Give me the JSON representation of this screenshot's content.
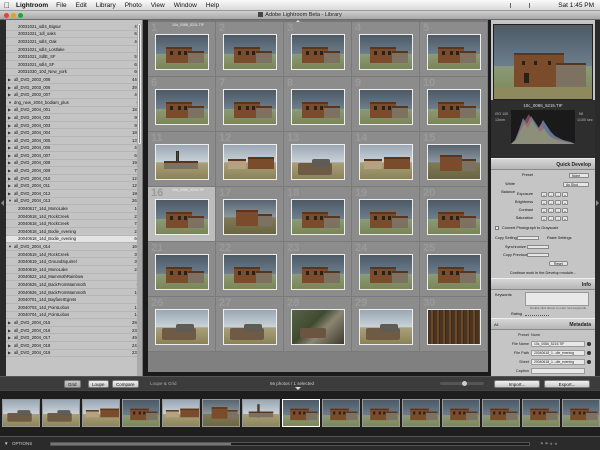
{
  "menubar": {
    "app": "Lightroom",
    "items": [
      "File",
      "Edit",
      "Library",
      "Photo",
      "View",
      "Window",
      "Help"
    ],
    "clock": "Sat 1:45 PM"
  },
  "window": {
    "title": "Adobe Lightroom Beta - Library"
  },
  "folders": [
    {
      "label": "20031021_sdl4_Bigsur",
      "count": "47"
    },
    {
      "label": "20031021_1dl_oaks",
      "count": "63"
    },
    {
      "label": "20031021_sdl4_Oak",
      "count": "46"
    },
    {
      "label": "20031021_sdl4_Lostlake",
      "count": "4"
    },
    {
      "label": "20031021_SdlE_SF",
      "count": "57"
    },
    {
      "label": "20031021_sdl4_SF",
      "count": "68"
    },
    {
      "label": "20031030_10d_New_york",
      "count": "60"
    },
    {
      "label": "all_DVD_2003_008",
      "count": "446",
      "toggle": "▶"
    },
    {
      "label": "all_DVD_2003_006",
      "count": "397",
      "toggle": "▶"
    },
    {
      "label": "all_DVD_2003_007",
      "count": "46",
      "toggle": "▶"
    },
    {
      "label": "dng_new_2004_bodiam_plus",
      "count": "0",
      "toggle": "▼"
    },
    {
      "label": "all_DVD_2004_001",
      "count": "182",
      "toggle": "▶"
    },
    {
      "label": "all_DVD_2004_002",
      "count": "90",
      "toggle": "▶"
    },
    {
      "label": "all_DVD_2004_003",
      "count": "95",
      "toggle": "▶"
    },
    {
      "label": "all_DVD_2004_004",
      "count": "188",
      "toggle": "▶"
    },
    {
      "label": "all_DVD_2004_005",
      "count": "137",
      "toggle": "▶"
    },
    {
      "label": "all_DVD_2004_006",
      "count": "43",
      "toggle": "▶"
    },
    {
      "label": "all_DVD_2004_007",
      "count": "63",
      "toggle": "▶"
    },
    {
      "label": "all_DVD_2004_008",
      "count": "194",
      "toggle": "▶"
    },
    {
      "label": "all_DVD_2004_009",
      "count": "73",
      "toggle": "▶"
    },
    {
      "label": "all_DVD_2004_010",
      "count": "122",
      "toggle": "▶"
    },
    {
      "label": "all_DVD_2004_011",
      "count": "129",
      "toggle": "▶"
    },
    {
      "label": "all_DVD_2004_012",
      "count": "180",
      "toggle": "▶"
    },
    {
      "label": "all_DVD_2004_013",
      "count": "263",
      "toggle": "▼"
    },
    {
      "label": "20040617_14d_MonoLake",
      "count": "16"
    },
    {
      "label": "20040618_14d_RockCreek",
      "count": "23"
    },
    {
      "label": "20040618_14d_RockCreek",
      "count": "74"
    },
    {
      "label": "20040618_14d_Bodie_evening",
      "count": "24"
    },
    {
      "label": "20040618_14d_Bodie_evening",
      "count": "66",
      "selected": true
    },
    {
      "label": "all_DVD_2004_014",
      "count": "169",
      "toggle": "▼"
    },
    {
      "label": "20040619_14d_RockCreek",
      "count": "35"
    },
    {
      "label": "20040619_14d_GroundSquirrel",
      "count": "39"
    },
    {
      "label": "20040619_14d_MonoLake",
      "count": "24"
    },
    {
      "label": "20040622_14d_MammothRainbow",
      "count": "2"
    },
    {
      "label": "20040625_14d_BackFromMammoth",
      "count": "5"
    },
    {
      "label": "20040626_14d_BackFromMammoth",
      "count": "15"
    },
    {
      "label": "20040701_14d_BayfarerEgrets",
      "count": "3"
    },
    {
      "label": "20040703_14d_PointLobos",
      "count": "17"
    },
    {
      "label": "20040704_14d_PointLobos",
      "count": "13"
    },
    {
      "label": "all_DVD_2004_015",
      "count": "284",
      "toggle": "▶"
    },
    {
      "label": "all_DVD_2004_016",
      "count": "233",
      "toggle": "▶"
    },
    {
      "label": "all_DVD_2004_017",
      "count": "494",
      "toggle": "▶"
    },
    {
      "label": "all_DVD_2004_018",
      "count": "243",
      "toggle": "▶"
    },
    {
      "label": "all_DVD_2004_019",
      "count": "233",
      "toggle": "▶"
    }
  ],
  "grid": {
    "cells": [
      {
        "num": "1",
        "fname": "10d_0086_5211.TIF"
      },
      {
        "num": "2",
        "fname": ""
      },
      {
        "num": "3",
        "fname": ""
      },
      {
        "num": "4",
        "fname": ""
      },
      {
        "num": "5",
        "fname": ""
      },
      {
        "num": "6",
        "fname": ""
      },
      {
        "num": "7",
        "fname": ""
      },
      {
        "num": "8",
        "fname": ""
      },
      {
        "num": "9",
        "fname": ""
      },
      {
        "num": "10",
        "fname": ""
      },
      {
        "num": "11",
        "fname": ""
      },
      {
        "num": "12",
        "fname": ""
      },
      {
        "num": "13",
        "fname": ""
      },
      {
        "num": "14",
        "fname": ""
      },
      {
        "num": "15",
        "fname": ""
      },
      {
        "num": "16",
        "fname": "10d_0086_5215.TIF",
        "selected": true
      },
      {
        "num": "17",
        "fname": ""
      },
      {
        "num": "18",
        "fname": ""
      },
      {
        "num": "19",
        "fname": ""
      },
      {
        "num": "20",
        "fname": ""
      },
      {
        "num": "21",
        "fname": ""
      },
      {
        "num": "22",
        "fname": ""
      },
      {
        "num": "23",
        "fname": ""
      },
      {
        "num": "24",
        "fname": ""
      },
      {
        "num": "25",
        "fname": ""
      },
      {
        "num": "26",
        "fname": ""
      },
      {
        "num": "27",
        "fname": ""
      },
      {
        "num": "28",
        "fname": ""
      },
      {
        "num": "29",
        "fname": ""
      },
      {
        "num": "30",
        "fname": ""
      }
    ]
  },
  "histogram": {
    "filename": "10c_0086_5215.TIF",
    "iso": "ISO 100",
    "focal": "13mm",
    "aperture": "f/8",
    "shutter": "1/100 sec"
  },
  "quick_develop": {
    "header": "Quick Develop",
    "preset_label": "Preset",
    "preset_value": "None",
    "wb_label": "White Balance",
    "wb_value": "As Shot",
    "exposure_label": "Exposure",
    "brightness_label": "Brightness",
    "contrast_label": "Contrast",
    "saturation_label": "Saturation",
    "grayscale_label": "Convert Photograph to Grayscale",
    "copy_settings_label": "Copy Settings",
    "paste_settings_label": "Paste Settings",
    "synchronize_label": "Synchronize",
    "copy_previous_label": "Copy Previous",
    "reset_label": "Reset",
    "continue_label": "Continue work in the Develop module..."
  },
  "info": {
    "header": "Info",
    "keywords_label": "Keywords",
    "keywords_hint": "Double click above to enter new keywords",
    "rating_label": "Rating"
  },
  "metadata": {
    "header": "Metadata",
    "dropdown": "All",
    "preset_label": "Preset",
    "preset_value": "None",
    "rows": [
      {
        "k": "File Name",
        "v": "10c_0086_5215.TIF"
      },
      {
        "k": "File Path",
        "v": "20040618_1...die_evening"
      },
      {
        "k": "Sheet",
        "v": "20040618_1...die_evening"
      },
      {
        "k": "Caption",
        "v": ""
      },
      {
        "k": "Copyright",
        "v": ""
      },
      {
        "k": "Job",
        "v": ""
      }
    ]
  },
  "toolbar": {
    "grid_label": "Grid",
    "loupe_label": "Loupe",
    "compare_label": "Compare",
    "sort_label": "Loupe & Grid",
    "status": "66 photos / 1 selected",
    "import_label": "Import...",
    "export_label": "Export..."
  },
  "statusbar": {
    "options_label": "OPTIONS"
  },
  "colors": {
    "panel_bg": "#c4c4c4",
    "grid_bg": "#808080",
    "dark_chrome": "#1b1b1b"
  }
}
